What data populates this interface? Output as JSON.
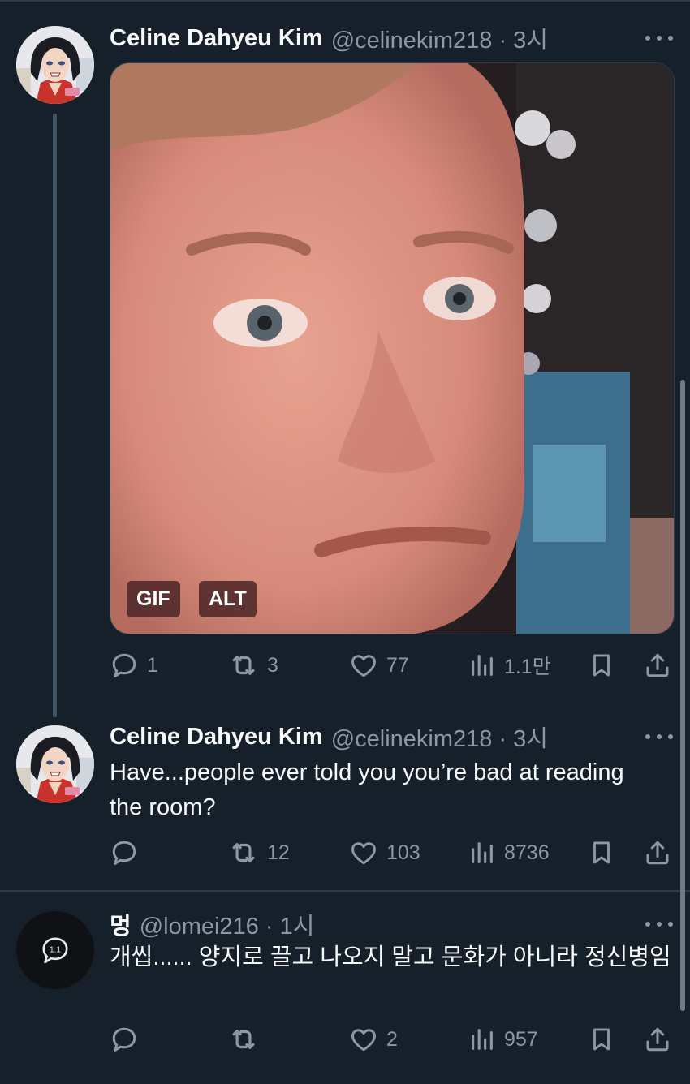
{
  "colors": {
    "background": "#15202b",
    "text": "#f7f9f9",
    "muted": "#8b98a5",
    "divider": "#2f3b47"
  },
  "tweets": [
    {
      "name": "Celine Dahyeu Kim",
      "handle_time": "@celinekim218 · 3시",
      "media": {
        "badges": [
          "GIF",
          "ALT"
        ]
      },
      "stats": {
        "reply": "1",
        "retweet": "3",
        "like": "77",
        "views": "1.1만"
      }
    },
    {
      "name": "Celine Dahyeu Kim",
      "handle_time": "@celinekim218 · 3시",
      "text": "Have...people ever told you you’re bad at reading the room?",
      "stats": {
        "reply": "",
        "retweet": "12",
        "like": "103",
        "views": "8736"
      }
    },
    {
      "name": "멍",
      "handle_time": "@lomei216 · 1시",
      "avatar_badge": "1:1",
      "text": "개씹...... 양지로 끌고 나오지 말고 문화가 아니라 정신병임",
      "stats": {
        "reply": "",
        "retweet": "",
        "like": "2",
        "views": "957"
      }
    }
  ]
}
